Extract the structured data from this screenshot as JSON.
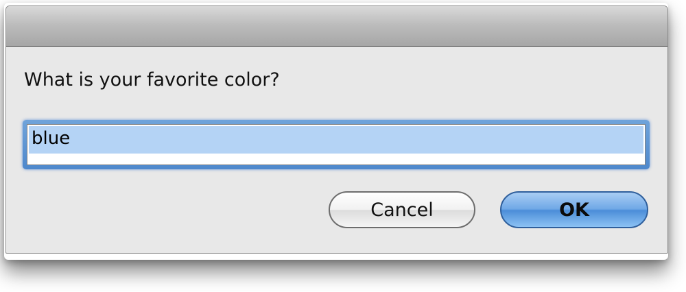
{
  "dialog": {
    "prompt": "What is your favorite color?",
    "input_value": "blue",
    "cancel_label": "Cancel",
    "ok_label": "OK"
  },
  "colors": {
    "dialog_background": "#e8e8e8",
    "selection": "#b4d3f5",
    "focus_ring": "#5b93d3",
    "default_button": "#6fa8e6"
  }
}
